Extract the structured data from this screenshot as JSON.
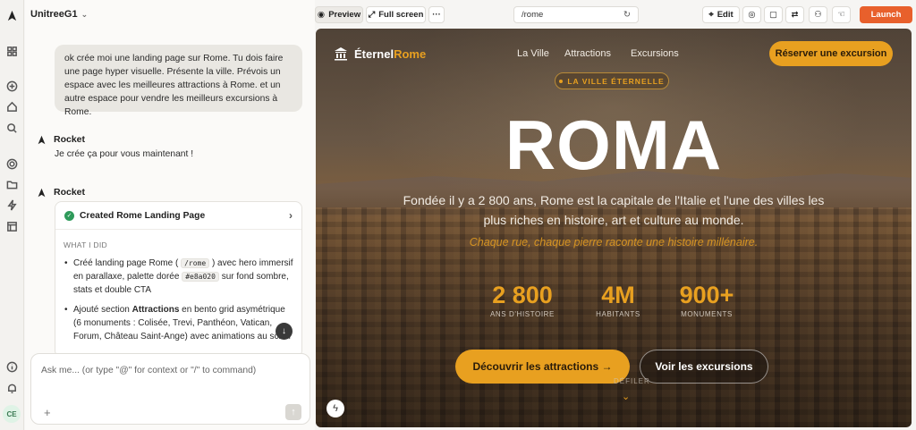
{
  "workspace": {
    "name": "UnitreeG1"
  },
  "user": {
    "avatar_initials": "CE"
  },
  "chat": {
    "user_message": "ok crée moi une landing page sur Rome. Tu dois faire une page hyper visuelle. Présente la ville. Prévois un espace avec les meilleures attractions à Rome. et un autre espace pour vendre les meilleurs excursions à Rome.",
    "agent_name": "Rocket",
    "agent_reply": "Je crée ça pour vous maintenant !",
    "card": {
      "title": "Created Rome Landing Page",
      "section_label": "WHAT I DID",
      "item1_a": "Créé landing page Rome ( ",
      "item1_code1": "/rome",
      "item1_b": " ) avec hero immersif en parallaxe, palette dorée ",
      "item1_code2": "#e8a020",
      "item1_c": " sur fond sombre, stats et double CTA",
      "item2_a": "Ajouté section ",
      "item2_bold": "Attractions",
      "item2_b": " en bento grid asymétrique (6 monuments : Colisée, Trevi, Panthéon, Vatican, Forum, Château Saint-Ange) avec animations au scroll"
    },
    "composer_placeholder": "Ask me... (or type \"@\" for context or \"/\" to command)"
  },
  "toolbar": {
    "preview": "Preview",
    "fullscreen": "Full screen",
    "more": "···",
    "url": "/rome",
    "edit": "Edit",
    "launch": "Launch"
  },
  "site": {
    "brand_a": "Éternel",
    "brand_b": "Rome",
    "nav": [
      "La Ville",
      "Attractions",
      "Excursions"
    ],
    "reserve": "Réserver une excursion",
    "tagline": "LA VILLE ÉTERNELLE",
    "hero_title": "ROMA",
    "hero_sub": "Fondée il y a 2 800 ans, Rome est la capitale de l'Italie et l'une des villes les plus riches en histoire, art et culture au monde.",
    "hero_sub2": "Chaque rue, chaque pierre raconte une histoire millénaire.",
    "stats": [
      {
        "value": "2 800",
        "label": "ANS D'HISTOIRE"
      },
      {
        "value": "4M",
        "label": "HABITANTS"
      },
      {
        "value": "900+",
        "label": "MONUMENTS"
      }
    ],
    "cta_primary": "Découvrir les attractions →",
    "cta_secondary": "Voir les excursions",
    "scroll_hint": "DÉFILER"
  },
  "colors": {
    "accent": "#e8a020",
    "launch": "#e8602c"
  }
}
